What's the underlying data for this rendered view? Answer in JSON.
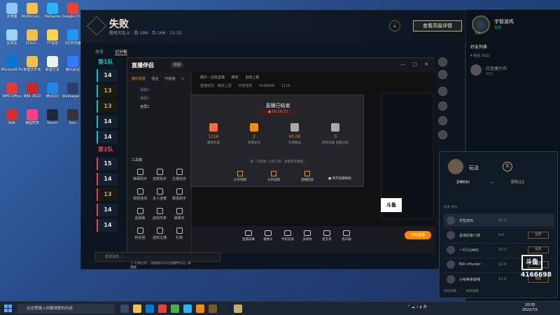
{
  "desktop": {
    "icons": [
      {
        "label": "此电脑",
        "color": "#8ec5ff"
      },
      {
        "label": "MyDocum...",
        "color": "#f5c04a"
      },
      {
        "label": "WeGame",
        "color": "#29b6f6"
      },
      {
        "label": "Google Chrome",
        "color": "#ea4335"
      },
      {
        "label": "回收站",
        "color": "#9fd3ff"
      },
      {
        "label": "2022/...",
        "color": "#f5c04a"
      },
      {
        "label": "YY语音",
        "color": "#ffd54f"
      },
      {
        "label": "QQ浏览器",
        "color": "#2196f3"
      },
      {
        "label": "Microsoft Edge",
        "color": "#0078d7"
      },
      {
        "label": "新建文件夹",
        "color": "#f5c04a"
      },
      {
        "label": "新建文本",
        "color": "#eeeeee"
      },
      {
        "label": "腾讯会议",
        "color": "#2e7dff"
      },
      {
        "label": "WPS Office",
        "color": "#e53935"
      },
      {
        "label": "NBA 2K22",
        "color": "#c62828"
      },
      {
        "label": "腾讯QQ",
        "color": "#1e88e5"
      },
      {
        "label": "Wallpaper Engine",
        "color": "#2a3f6a"
      },
      {
        "label": "网易",
        "color": "#d32f2f"
      },
      {
        "label": "美图秀秀",
        "color": "#ff4081"
      },
      {
        "label": "Steam",
        "color": "#1b2838"
      },
      {
        "label": "Epic",
        "color": "#333333"
      }
    ]
  },
  "lol": {
    "title": "失败",
    "subtitle": "极地大乱斗 · 胜:184 · 负:166 · 13:32",
    "detail_button": "查看高级详情",
    "download_icon": "⤓",
    "tabs": [
      "总览",
      "记分板"
    ],
    "team1": "第1队",
    "team2": "第2队",
    "rows1": [
      "14",
      "13",
      "13",
      "14",
      "14"
    ],
    "rows2": [
      "15",
      "14",
      "13",
      "14",
      "14"
    ]
  },
  "client": {
    "player_name": "宇智波鸡",
    "player_status": "在线",
    "player_level": "156",
    "friend_list_title": "好友列表",
    "friend_group": "▾ 综合 (0/1)",
    "friend_name": "红色魔力鸟",
    "friend_status": "离线"
  },
  "live": {
    "logo": "直播伴侣",
    "version": "新版",
    "window_buttons": "— ▢ ✕",
    "side_tabs": [
      "我的场景",
      "组名",
      "可拖拽",
      "+"
    ],
    "scenes": [
      "场景1",
      "场景2",
      "全屏1"
    ],
    "section_title": "工具箱",
    "tools": [
      {
        "label": "弹幕助手"
      },
      {
        "label": "连麦助手"
      },
      {
        "label": "主播任务"
      },
      {
        "label": "视频连线"
      },
      {
        "label": "多人连麦"
      },
      {
        "label": "赛事助手"
      },
      {
        "label": "送弹幕"
      },
      {
        "label": "虚拟形象"
      },
      {
        "label": "弹幕鸡"
      },
      {
        "label": "粉丝团"
      },
      {
        "label": "虚拟主播"
      },
      {
        "label": "礼物"
      }
    ],
    "status_bar": [
      "娱乐—全民直播",
      "推流",
      "自动上报",
      "直播状态 · 推流上报",
      "宇智波鸡",
      "4166698",
      "1116"
    ],
    "overlay": {
      "title": "直播已结束",
      "time": "● 00:16:27",
      "stats": [
        {
          "value": "1116",
          "label": "最高热度"
        },
        {
          "value": "2",
          "label": "新增关注"
        },
        {
          "value": "¥0.00",
          "label": "礼物收益"
        },
        {
          "value": "0",
          "label": "新粉丝数 查看记录"
        }
      ],
      "link": "第一次直播? 立即了解 ›  查看更多数据 ›",
      "actions": [
        {
          "label": "分享视频"
        },
        {
          "label": "分享战绩"
        },
        {
          "label": "直播回放"
        }
      ],
      "checkbox": "■ 保存直播数据"
    },
    "bottom_buttons": [
      "直播屏幕",
      "摄像头",
      "手机投屏",
      "多媒体",
      "麦克风",
      "扬声器"
    ],
    "start_button": "开始直播",
    "notice": "ⓘ 礼物已达... 此面板可以在直播中开启, 请遵循"
  },
  "popup": {
    "name": "玩法",
    "badge": "奖",
    "stat1_value": "14min",
    "stat1_label": "游戏时长",
    "stat2_value": "--",
    "stat2_label": "",
    "stat3_value": "2/6/22",
    "stat3_label": "KDA",
    "col_header": "队友          评分",
    "players": [
      {
        "name": "宇智波鸡",
        "score": "10.3",
        "report": ""
      },
      {
        "name": "是他的第六感",
        "score": "9.0",
        "report": "拉黑"
      },
      {
        "name": "一行七QWQ",
        "score": "10.3",
        "report": "拉黑"
      },
      {
        "name": "BIO nHunter",
        "score": "12.4",
        "report": "拉黑"
      },
      {
        "name": "小哈等拿破喂",
        "score": "12.4",
        "report": "拉黑"
      }
    ],
    "footer": [
      "对局详情",
      "本场关键"
    ]
  },
  "watermark": {
    "logo": "斗鱼",
    "room": "4166698"
  },
  "chatbar": {
    "placeholder": "发送消息..."
  },
  "taskbar": {
    "search_placeholder": "在这里输入你要搜索的内容",
    "clock_time": "20:55",
    "clock_date": "2022/7/1"
  }
}
